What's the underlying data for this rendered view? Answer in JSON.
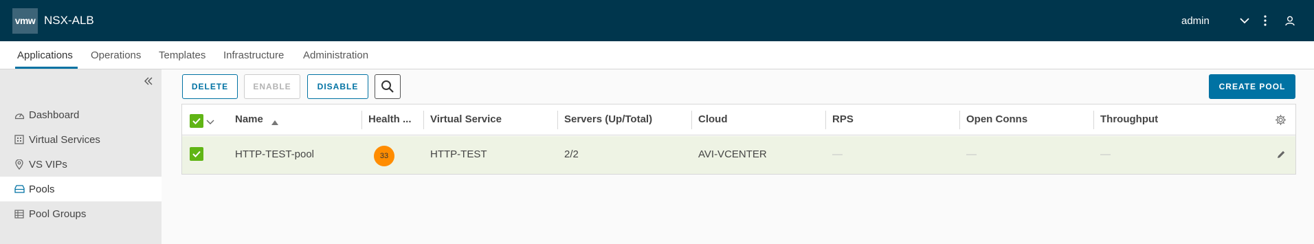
{
  "header": {
    "logo": "vmw",
    "title": "NSX-ALB",
    "user": "admin",
    "icons": [
      "chevron-down-icon",
      "more-vertical-icon",
      "user-icon"
    ]
  },
  "nav": {
    "tabs": [
      {
        "label": "Applications",
        "active": true
      },
      {
        "label": "Operations"
      },
      {
        "label": "Templates"
      },
      {
        "label": "Infrastructure"
      },
      {
        "label": "Administration"
      }
    ]
  },
  "sidebar": {
    "items": [
      {
        "label": "Dashboard",
        "icon": "dashboard-icon"
      },
      {
        "label": "Virtual Services",
        "icon": "virtual-services-icon"
      },
      {
        "label": "VS VIPs",
        "icon": "map-pin-icon"
      },
      {
        "label": "Pools",
        "icon": "pool-icon",
        "active": true
      },
      {
        "label": "Pool Groups",
        "icon": "pool-groups-icon"
      }
    ]
  },
  "toolbar": {
    "delete": "DELETE",
    "enable": "ENABLE",
    "disable": "DISABLE",
    "create": "CREATE POOL"
  },
  "table": {
    "columns": [
      "Name",
      "Health ...",
      "Virtual Service",
      "Servers (Up/Total)",
      "Cloud",
      "RPS",
      "Open Conns",
      "Throughput"
    ],
    "rows": [
      {
        "name": "HTTP-TEST-pool",
        "health": "33",
        "virtual_service": "HTTP-TEST",
        "servers": "2/2",
        "cloud": "AVI-VCENTER",
        "rps": "—",
        "open_conns": "—",
        "throughput": "—"
      }
    ]
  },
  "colors": {
    "header_bg": "#00364d",
    "accent": "#0072a3",
    "check_green": "#60b515",
    "row_selected": "#eef3e4",
    "health_orange": "#ff8c00"
  }
}
